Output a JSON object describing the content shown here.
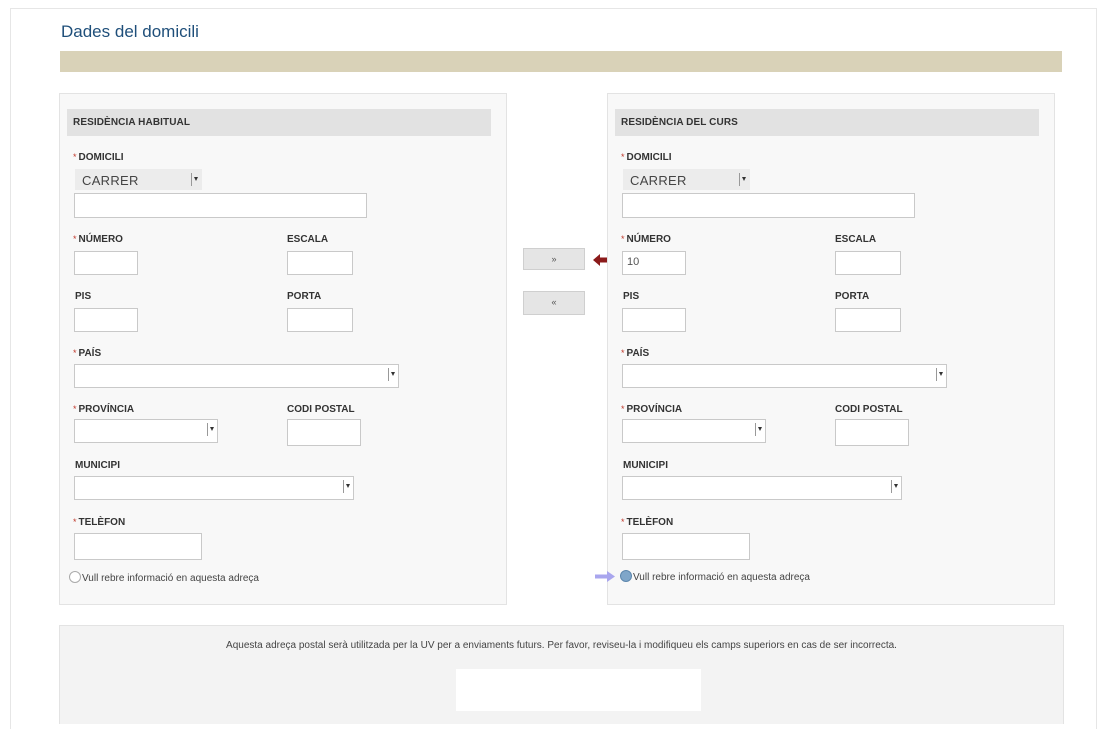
{
  "page": {
    "title": "Dades del domicili",
    "footer_message": "Aquesta adreça postal serà utilitzada per la UV per a enviaments futurs. Per favor, reviseu-la i modifiqueu els camps superiors en cas de ser incorrecta."
  },
  "copy_buttons": {
    "forward_label": "»",
    "back_label": "«"
  },
  "left": {
    "header": "RESIDÈNCIA HABITUAL",
    "domicili_label": "DOMICILI",
    "street_type": "CARRER",
    "street_value": "",
    "numero_label": "NÚMERO",
    "numero_value": "",
    "escala_label": "ESCALA",
    "escala_value": "",
    "pis_label": "PIS",
    "pis_value": "",
    "porta_label": "PORTA",
    "porta_value": "",
    "pais_label": "PAÍS",
    "provincia_label": "PROVÍNCIA",
    "codi_postal_label": "CODI POSTAL",
    "codi_postal_value": "",
    "municipi_label": "MUNICIPI",
    "telefon_label": "TELÈFON",
    "telefon_value": "",
    "radio_label": "Vull rebre informació en aquesta adreça",
    "radio_checked": false
  },
  "right": {
    "header": "RESIDÈNCIA DEL CURS",
    "domicili_label": "DOMICILI",
    "street_type": "CARRER",
    "street_value": "",
    "numero_label": "NÚMERO",
    "numero_value": "10",
    "escala_label": "ESCALA",
    "escala_value": "",
    "pis_label": "PIS",
    "pis_value": "",
    "porta_label": "PORTA",
    "porta_value": "",
    "pais_label": "PAÍS",
    "provincia_label": "PROVÍNCIA",
    "codi_postal_label": "CODI POSTAL",
    "codi_postal_value": "",
    "municipi_label": "MUNICIPI",
    "telefon_label": "TELÈFON",
    "telefon_value": "",
    "radio_label": "Vull rebre informació en aquesta adreça",
    "radio_checked": true
  },
  "colors": {
    "title": "#1f4f7a",
    "bar": "#d9d2b8",
    "required_marker": "#c0392b",
    "annotation_arrow_red": "#8b1a1a",
    "annotation_arrow_blue": "#a9a6ee"
  },
  "icons": {
    "annotation_red": "arrow-left-icon",
    "annotation_blue": "arrow-right-icon"
  }
}
